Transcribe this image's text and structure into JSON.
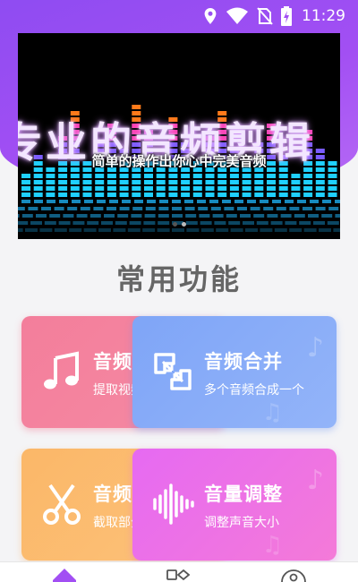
{
  "status_bar": {
    "time": "11:29"
  },
  "banner": {
    "title": "专业的音频剪辑",
    "subtitle": "简单的操作出你心中完美音频",
    "page_count": 2,
    "active_page": 1
  },
  "section": {
    "title": "常用功能"
  },
  "cards": [
    {
      "title": "音频提取",
      "subtitle": "提取视频中的音频",
      "icon": "music-note-icon"
    },
    {
      "title": "音频合并",
      "subtitle": "多个音频合成一个",
      "icon": "merge-icon"
    },
    {
      "title": "音频剪切",
      "subtitle": "截取部分音频",
      "icon": "scissors-icon"
    },
    {
      "title": "音量调整",
      "subtitle": "调整声音大小",
      "icon": "waveform-icon"
    }
  ],
  "bottom_nav": {
    "items": [
      "home-icon",
      "tools-icon",
      "profile-icon"
    ]
  },
  "colors": {
    "header": "#a24ff3",
    "card_pink": "#f37e9b",
    "card_blue": "#7fa5f7",
    "card_orange": "#fbb768",
    "card_magenta": "#e66af2"
  }
}
